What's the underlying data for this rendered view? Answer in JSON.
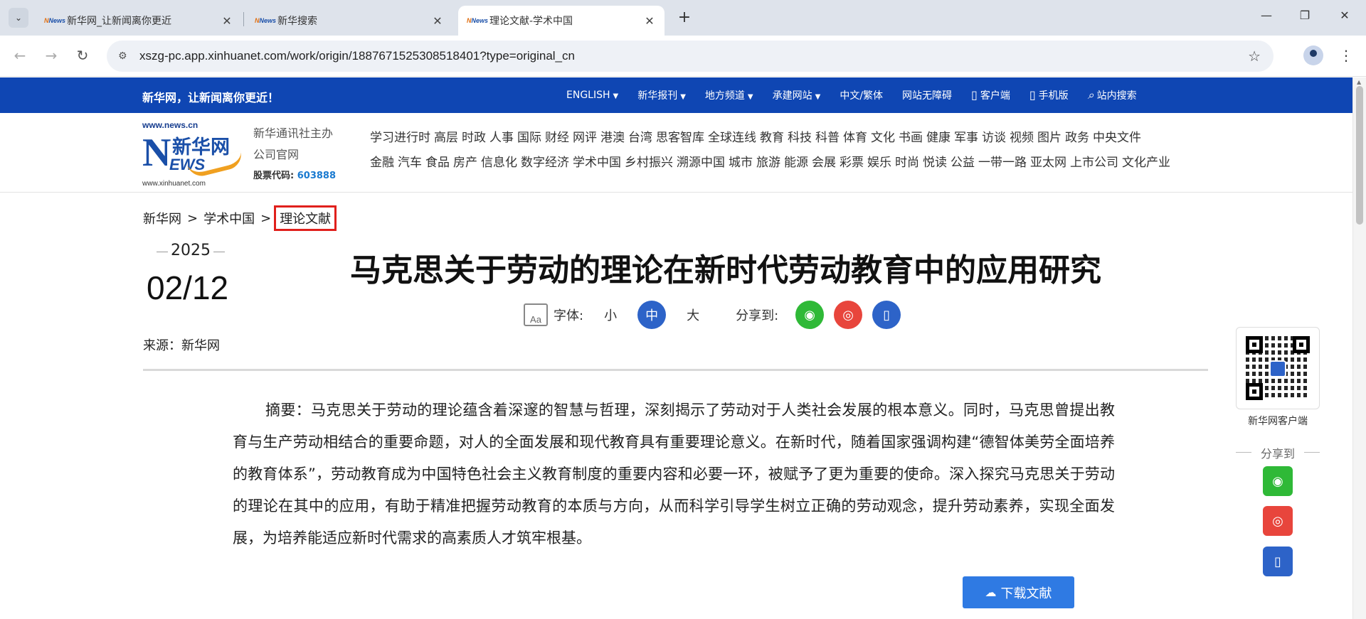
{
  "browser": {
    "tabs": [
      {
        "title": "新华网_让新闻离你更近",
        "active": false
      },
      {
        "title": "新华搜索",
        "active": false
      },
      {
        "title": "理论文献-学术中国",
        "active": true
      }
    ],
    "favicon_text": "News",
    "url": "xszg-pc.app.xinhuanet.com/work/origin/1887671525308518401?type=original_cn"
  },
  "site": {
    "slogan": "新华网，让新闻离你更近！",
    "topnav": [
      {
        "label": "ENGLISH",
        "dropdown": true,
        "icon": ""
      },
      {
        "label": "新华报刊",
        "dropdown": true,
        "icon": ""
      },
      {
        "label": "地方频道",
        "dropdown": true,
        "icon": ""
      },
      {
        "label": "承建网站",
        "dropdown": true,
        "icon": ""
      },
      {
        "label": "中文/繁体",
        "dropdown": false,
        "icon": ""
      },
      {
        "label": "网站无障碍",
        "dropdown": false,
        "icon": ""
      },
      {
        "label": "客户端",
        "dropdown": false,
        "icon": "phone-icon"
      },
      {
        "label": "手机版",
        "dropdown": false,
        "icon": "mobile-icon"
      },
      {
        "label": "站内搜索",
        "dropdown": false,
        "icon": "search-icon"
      }
    ],
    "logo": {
      "top_url": "www.news.cn",
      "brand_cn": "新华网",
      "brand_en_n": "N",
      "brand_en_rest": "EWS",
      "bottom_url": "www.xinhuanet.com"
    },
    "org": {
      "line1": "新华通讯社主办",
      "line2": "公司官网",
      "stock_label": "股票代码:",
      "stock_code": "603888"
    },
    "channels_row1": [
      "学习进行时",
      "高层",
      "时政",
      "人事",
      "国际",
      "财经",
      "网评",
      "港澳",
      "台湾",
      "思客智库",
      "全球连线",
      "教育",
      "科技",
      "科普",
      "体育",
      "文化",
      "书画",
      "健康",
      "军事",
      "访谈",
      "视频",
      "图片",
      "政务",
      "中央文件"
    ],
    "channels_row2": [
      "金融",
      "汽车",
      "食品",
      "房产",
      "信息化",
      "数字经济",
      "学术中国",
      "乡村振兴",
      "溯源中国",
      "城市",
      "旅游",
      "能源",
      "会展",
      "彩票",
      "娱乐",
      "时尚",
      "悦读",
      "公益",
      "一带一路",
      "亚太网",
      "上市公司",
      "文化产业"
    ]
  },
  "breadcrumb": {
    "items": [
      "新华网",
      "学术中国"
    ],
    "separator": ">",
    "current": "理论文献"
  },
  "article": {
    "year": "2025",
    "month_day": "02/12",
    "source": "来源：新华网",
    "title": "马克思关于劳动的理论在新时代劳动教育中的应用研究",
    "font_label": "字体:",
    "font_icon_text": "Aa",
    "font_sizes": [
      "小",
      "中",
      "大"
    ],
    "active_font_size": "中",
    "share_label": "分享到:",
    "abstract": "摘要：马克思关于劳动的理论蕴含着深邃的智慧与哲理，深刻揭示了劳动对于人类社会发展的根本意义。同时，马克思曾提出教育与生产劳动相结合的重要命题，对人的全面发展和现代教育具有重要理论意义。在新时代，随着国家强调构建“德智体美劳全面培养的教育体系”，劳动教育成为中国特色社会主义教育制度的重要内容和必要一环，被赋予了更为重要的使命。深入探究马克思关于劳动的理论在其中的应用，有助于精准把握劳动教育的本质与方向，从而科学引导学生树立正确的劳动观念，提升劳动素养，实现全面发展，为培养能适应新时代需求的高素质人才筑牢根基。",
    "download_label": "下载文献"
  },
  "sidebar": {
    "qr_label": "新华网客户端",
    "share_label": "分享到"
  },
  "colors": {
    "brand_blue": "#0f46b3",
    "highlight_red": "#e0201c",
    "wechat_green": "#2fb937",
    "weibo_red": "#e8453c",
    "download_blue": "#2f7ae3"
  }
}
